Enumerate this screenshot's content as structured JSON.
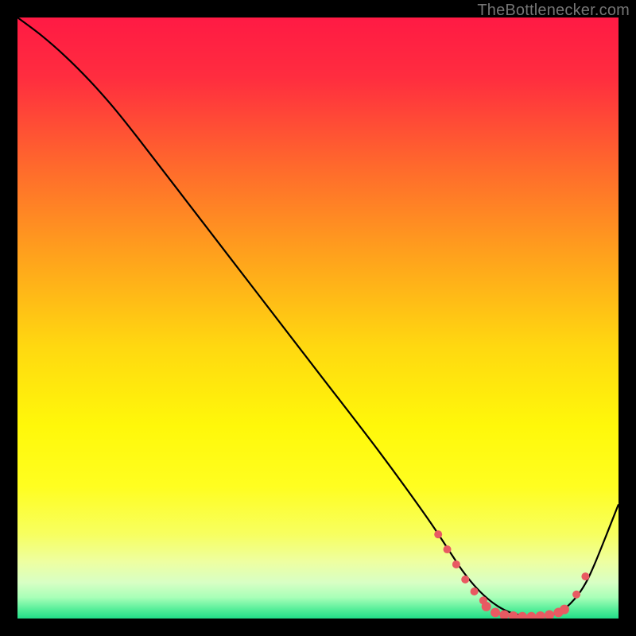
{
  "attribution": "TheBottlenecker.com",
  "chart_data": {
    "type": "line",
    "title": "",
    "xlabel": "",
    "ylabel": "",
    "xlim": [
      0,
      100
    ],
    "ylim": [
      0,
      100
    ],
    "background_gradient_stops": [
      {
        "offset": 0.0,
        "color": "#ff1a44"
      },
      {
        "offset": 0.1,
        "color": "#ff2d3f"
      },
      {
        "offset": 0.25,
        "color": "#ff6a2c"
      },
      {
        "offset": 0.4,
        "color": "#ffa31c"
      },
      {
        "offset": 0.55,
        "color": "#ffd910"
      },
      {
        "offset": 0.68,
        "color": "#fff80a"
      },
      {
        "offset": 0.78,
        "color": "#fffe20"
      },
      {
        "offset": 0.86,
        "color": "#f7ff60"
      },
      {
        "offset": 0.905,
        "color": "#eeffa0"
      },
      {
        "offset": 0.94,
        "color": "#d8ffc4"
      },
      {
        "offset": 0.965,
        "color": "#a8ffb8"
      },
      {
        "offset": 0.985,
        "color": "#55ee99"
      },
      {
        "offset": 1.0,
        "color": "#22dd88"
      }
    ],
    "series": [
      {
        "name": "bottleneck-curve",
        "stroke": "#000000",
        "x": [
          0,
          4,
          8,
          12,
          16,
          20,
          30,
          40,
          50,
          60,
          68,
          72,
          74,
          76,
          78,
          80,
          82,
          84,
          86,
          88,
          90,
          92,
          94,
          96,
          100
        ],
        "y": [
          100,
          97,
          93.5,
          89.5,
          85,
          80,
          67,
          54,
          41,
          28,
          17,
          11,
          8,
          5.5,
          3.5,
          2,
          1,
          0.5,
          0.3,
          0.4,
          1,
          2.5,
          5,
          9,
          19
        ]
      }
    ],
    "highlight_points": {
      "color": "#e85a62",
      "radius_small": 5,
      "radius_large": 6,
      "points": [
        {
          "x": 70.0,
          "y": 14.0,
          "r": "small"
        },
        {
          "x": 71.5,
          "y": 11.5,
          "r": "small"
        },
        {
          "x": 73.0,
          "y": 9.0,
          "r": "small"
        },
        {
          "x": 74.5,
          "y": 6.5,
          "r": "small"
        },
        {
          "x": 76.0,
          "y": 4.5,
          "r": "small"
        },
        {
          "x": 77.5,
          "y": 3.0,
          "r": "small"
        },
        {
          "x": 78.0,
          "y": 2.0,
          "r": "large"
        },
        {
          "x": 79.5,
          "y": 1.0,
          "r": "large"
        },
        {
          "x": 81.0,
          "y": 0.6,
          "r": "large"
        },
        {
          "x": 82.5,
          "y": 0.4,
          "r": "large"
        },
        {
          "x": 84.0,
          "y": 0.3,
          "r": "large"
        },
        {
          "x": 85.5,
          "y": 0.3,
          "r": "large"
        },
        {
          "x": 87.0,
          "y": 0.4,
          "r": "large"
        },
        {
          "x": 88.5,
          "y": 0.6,
          "r": "large"
        },
        {
          "x": 90.0,
          "y": 1.0,
          "r": "large"
        },
        {
          "x": 91.0,
          "y": 1.5,
          "r": "large"
        },
        {
          "x": 93.0,
          "y": 4.0,
          "r": "small"
        },
        {
          "x": 94.5,
          "y": 7.0,
          "r": "small"
        }
      ]
    }
  }
}
